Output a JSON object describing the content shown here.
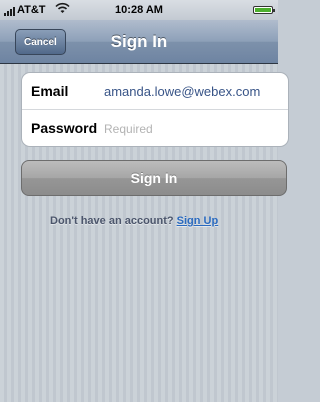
{
  "status_bar": {
    "carrier": "AT&T",
    "time": "10:28 AM",
    "wifi_icon": "wifi-icon",
    "battery_level": 1.0,
    "battery_color": "#4caf2d"
  },
  "nav_bar": {
    "title": "Sign In",
    "cancel_label": "Cancel"
  },
  "form": {
    "email_label": "Email",
    "email_value": "amanda.lowe@webex.com",
    "password_label": "Password",
    "password_placeholder": "Required"
  },
  "signin_button": {
    "label": "Sign In"
  },
  "signup": {
    "prompt": "Don't have an account?",
    "link": "Sign Up",
    "link_color": "#2a6abf"
  }
}
